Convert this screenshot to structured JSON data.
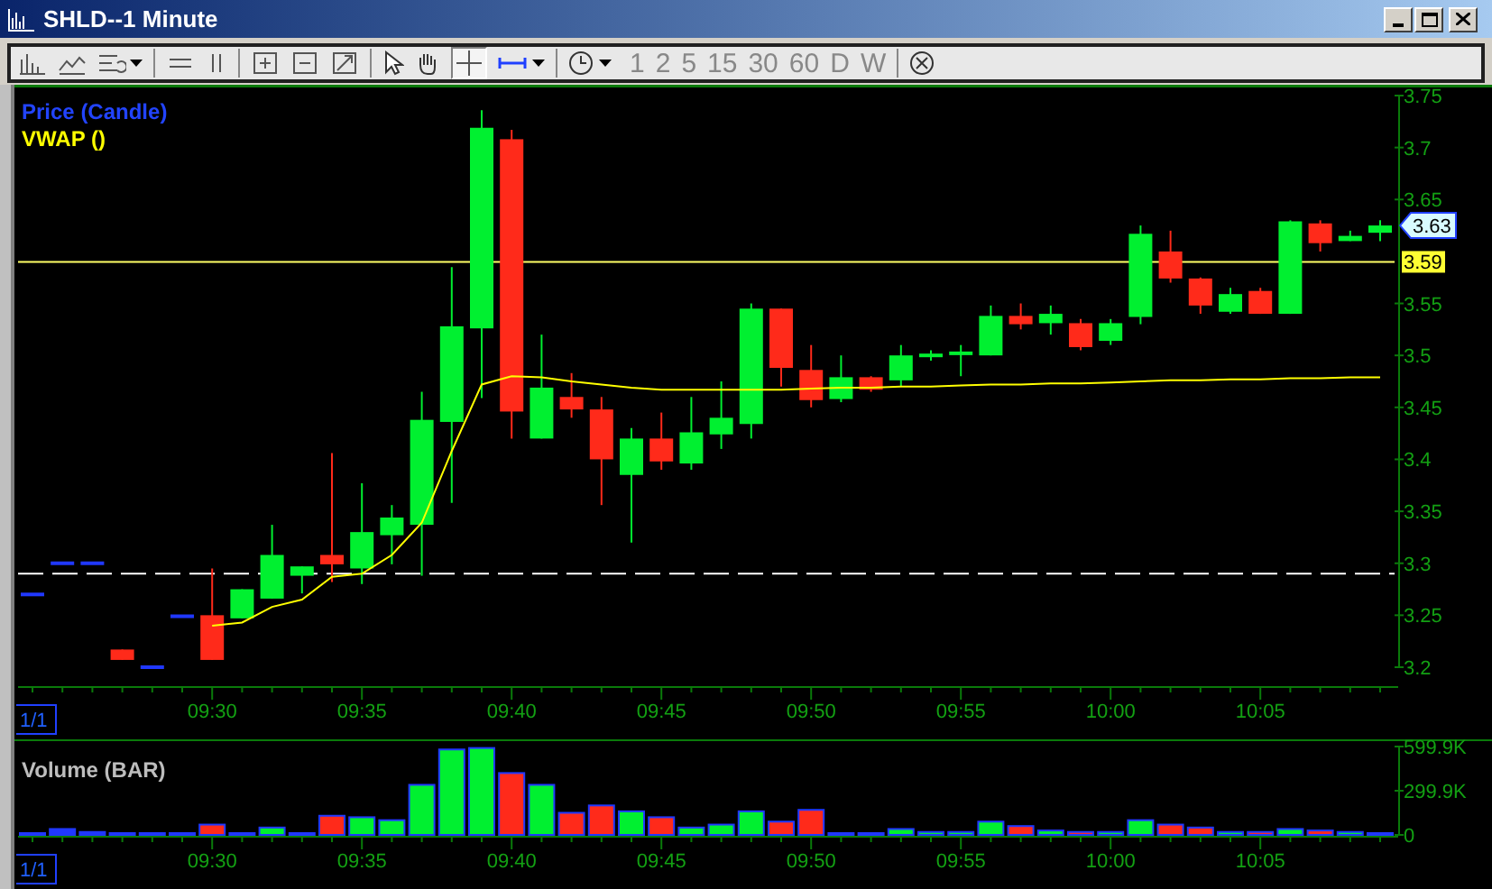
{
  "window": {
    "title": "SHLD--1 Minute"
  },
  "toolbar": {
    "periods": [
      "1",
      "2",
      "5",
      "15",
      "30",
      "60",
      "D",
      "W"
    ]
  },
  "price_panel": {
    "legends": [
      "Price (Candle)"
    ],
    "page_indicator": "1/1",
    "chart_data": {
      "type": "candlestick",
      "categories": [
        null,
        null,
        null,
        null,
        null,
        null,
        "09:30",
        null,
        null,
        null,
        null,
        "09:35",
        null,
        null,
        null,
        null,
        "09:40",
        null,
        null,
        null,
        null,
        "09:45",
        null,
        null,
        null,
        null,
        "09:50",
        null,
        null,
        null,
        null,
        "09:55",
        null,
        null,
        null,
        null,
        "10:00",
        null,
        null,
        null,
        null,
        "10:05",
        null,
        null,
        null,
        null
      ],
      "ohlc": [
        [
          3.27,
          3.27,
          3.27,
          3.27
        ],
        [
          3.3,
          3.3,
          3.3,
          3.3
        ],
        [
          3.3,
          3.3,
          3.3,
          3.3
        ],
        [
          3.217,
          3.217,
          3.207,
          3.207
        ],
        [
          3.2,
          3.2,
          3.2,
          3.2
        ],
        [
          3.249,
          3.249,
          3.249,
          3.249
        ],
        [
          3.25,
          3.295,
          3.207,
          3.207
        ],
        [
          3.247,
          3.275,
          3.247,
          3.275
        ],
        [
          3.266,
          3.337,
          3.266,
          3.308
        ],
        [
          3.288,
          3.297,
          3.271,
          3.297
        ],
        [
          3.308,
          3.406,
          3.282,
          3.299
        ],
        [
          3.295,
          3.377,
          3.28,
          3.33
        ],
        [
          3.327,
          3.356,
          3.299,
          3.344
        ],
        [
          3.337,
          3.465,
          3.288,
          3.438
        ],
        [
          3.436,
          3.585,
          3.358,
          3.528
        ],
        [
          3.526,
          3.736,
          3.459,
          3.719
        ],
        [
          3.708,
          3.717,
          3.42,
          3.446
        ],
        [
          3.42,
          3.52,
          3.42,
          3.469
        ],
        [
          3.46,
          3.483,
          3.44,
          3.448
        ],
        [
          3.448,
          3.46,
          3.356,
          3.4
        ],
        [
          3.385,
          3.43,
          3.32,
          3.42
        ],
        [
          3.42,
          3.445,
          3.39,
          3.398
        ],
        [
          3.396,
          3.46,
          3.39,
          3.426
        ],
        [
          3.424,
          3.475,
          3.41,
          3.44
        ],
        [
          3.434,
          3.55,
          3.42,
          3.545
        ],
        [
          3.545,
          3.545,
          3.47,
          3.488
        ],
        [
          3.486,
          3.51,
          3.45,
          3.457
        ],
        [
          3.458,
          3.5,
          3.455,
          3.479
        ],
        [
          3.479,
          3.48,
          3.465,
          3.467
        ],
        [
          3.476,
          3.51,
          3.47,
          3.5
        ],
        [
          3.497,
          3.505,
          3.495,
          3.5
        ],
        [
          3.5,
          3.51,
          3.48,
          3.502
        ],
        [
          3.5,
          3.548,
          3.5,
          3.538
        ],
        [
          3.538,
          3.55,
          3.525,
          3.53
        ],
        [
          3.531,
          3.548,
          3.52,
          3.54
        ],
        [
          3.531,
          3.535,
          3.505,
          3.508
        ],
        [
          3.514,
          3.535,
          3.51,
          3.531
        ],
        [
          3.537,
          3.625,
          3.53,
          3.617
        ],
        [
          3.6,
          3.62,
          3.57,
          3.574
        ],
        [
          3.574,
          3.575,
          3.54,
          3.548
        ],
        [
          3.542,
          3.565,
          3.54,
          3.559
        ],
        [
          3.562,
          3.565,
          3.54,
          3.54
        ],
        [
          3.54,
          3.63,
          3.54,
          3.629
        ],
        [
          3.627,
          3.63,
          3.6,
          3.608
        ],
        [
          3.61,
          3.62,
          3.61,
          3.615
        ],
        [
          3.618,
          3.63,
          3.61,
          3.625
        ]
      ],
      "series": [
        {
          "name": "VWAP ()",
          "type": "line",
          "color": "#ffff00",
          "values": [
            null,
            null,
            null,
            null,
            null,
            null,
            3.24,
            3.243,
            3.258,
            3.265,
            3.287,
            3.29,
            3.308,
            3.339,
            3.408,
            3.472,
            3.48,
            3.479,
            3.475,
            3.472,
            3.469,
            3.467,
            3.467,
            3.467,
            3.467,
            3.467,
            3.468,
            3.469,
            3.469,
            3.47,
            3.47,
            3.471,
            3.472,
            3.472,
            3.473,
            3.473,
            3.474,
            3.475,
            3.476,
            3.476,
            3.477,
            3.477,
            3.478,
            3.478,
            3.479,
            3.479
          ]
        }
      ],
      "ylim": [
        3.2,
        3.75
      ],
      "yticks": [
        3.2,
        3.25,
        3.3,
        3.35,
        3.4,
        3.45,
        3.5,
        3.55,
        3.65,
        3.7,
        3.75
      ],
      "ref_lines": [
        {
          "axis": "y",
          "value": 3.59,
          "label": "3.59"
        },
        {
          "axis": "y",
          "value": 3.29
        }
      ],
      "annotations": [
        "3.63"
      ]
    }
  },
  "volume_panel": {
    "legend": "Volume (BAR)",
    "page_indicator": "1/1",
    "chart_data": {
      "type": "bar",
      "categories": [
        null,
        null,
        null,
        null,
        null,
        null,
        "09:30",
        null,
        null,
        null,
        null,
        "09:35",
        null,
        null,
        null,
        null,
        "09:40",
        null,
        null,
        null,
        null,
        "09:45",
        null,
        null,
        null,
        null,
        "09:50",
        null,
        null,
        null,
        null,
        "09:55",
        null,
        null,
        null,
        null,
        "10:00",
        null,
        null,
        null,
        null,
        "10:05",
        null,
        null,
        null,
        null
      ],
      "values": [
        10000,
        40000,
        20000,
        10000,
        10000,
        10000,
        70000,
        10000,
        50000,
        10000,
        130000,
        120000,
        100000,
        340000,
        580000,
        590000,
        420000,
        340000,
        150000,
        200000,
        160000,
        120000,
        50000,
        70000,
        160000,
        90000,
        170000,
        10000,
        10000,
        40000,
        20000,
        20000,
        90000,
        60000,
        30000,
        20000,
        20000,
        100000,
        70000,
        50000,
        20000,
        20000,
        40000,
        30000,
        20000,
        10000
      ],
      "ylim": [
        0,
        599900
      ],
      "yticks": [
        {
          "value": 0,
          "label": "0"
        },
        {
          "value": 299900,
          "label": "299.9K"
        },
        {
          "value": 599900,
          "label": "599.9K"
        }
      ]
    }
  }
}
